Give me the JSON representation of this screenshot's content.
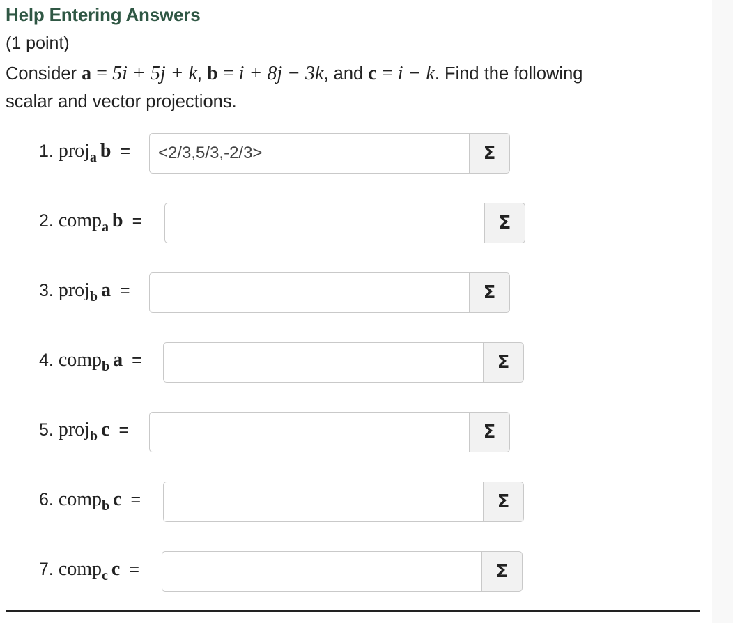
{
  "header": {
    "help_link": "Help Entering Answers",
    "points": "(1 point)"
  },
  "problem": {
    "consider": "Consider",
    "a_var": "a",
    "a_expr": "5i + 5j + k",
    "b_var": "b",
    "b_expr": "i + 8j − 3k",
    "and": "and",
    "c_var": "c",
    "c_expr": "i − k",
    "equals": "=",
    "comma": ",",
    "period": ".",
    "instruction_1": "Find the following",
    "instruction_2": "scalar and vector projections."
  },
  "questions": [
    {
      "number": "1.",
      "fn": "proj",
      "sub": "a",
      "vec": "b",
      "value": "<2/3,5/3,-2/3>"
    },
    {
      "number": "2.",
      "fn": "comp",
      "sub": "a",
      "vec": "b",
      "value": ""
    },
    {
      "number": "3.",
      "fn": "proj",
      "sub": "b",
      "vec": "a",
      "value": ""
    },
    {
      "number": "4.",
      "fn": "comp",
      "sub": "b",
      "vec": "a",
      "value": ""
    },
    {
      "number": "5.",
      "fn": "proj",
      "sub": "b",
      "vec": "c",
      "value": ""
    },
    {
      "number": "6.",
      "fn": "comp",
      "sub": "b",
      "vec": "c",
      "value": ""
    },
    {
      "number": "7.",
      "fn": "comp",
      "sub": "c",
      "vec": "c",
      "value": ""
    }
  ],
  "equation_button": {
    "symbol": "Σ"
  },
  "colors": {
    "help_link": "#2f5744",
    "input_border": "#c9c9c9",
    "button_bg": "#f2f2f2"
  }
}
